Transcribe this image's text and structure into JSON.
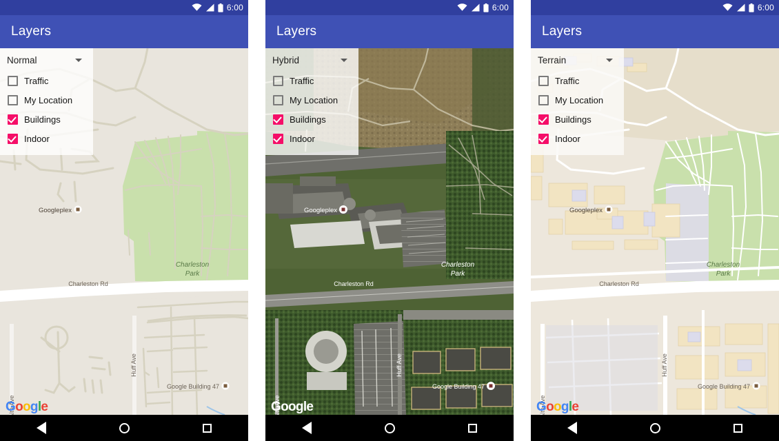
{
  "status_bar": {
    "time": "6:00",
    "icons": [
      "wifi-icon",
      "signal-icon",
      "battery-icon"
    ],
    "background": "#303F9F"
  },
  "app_bar": {
    "title": "Layers",
    "background": "#3F51B5"
  },
  "nav_bar": {
    "back_label": "Back",
    "home_label": "Home",
    "recents_label": "Recents"
  },
  "colors": {
    "accent_checkbox": "#F50E68",
    "app_bar": "#3F51B5",
    "status_bar": "#303F9F",
    "map_land": "#E9E5DD",
    "map_park": "#C9E0AC",
    "map_road": "#FFFFFF"
  },
  "watermark": {
    "letters": [
      "G",
      "o",
      "o",
      "g",
      "l",
      "e"
    ]
  },
  "panels": [
    {
      "id": "normal",
      "map_type": "Normal",
      "layers": [
        {
          "label": "Traffic",
          "checked": false
        },
        {
          "label": "My Location",
          "checked": false
        },
        {
          "label": "Buildings",
          "checked": true
        },
        {
          "label": "Indoor",
          "checked": true
        }
      ],
      "map_labels": {
        "poi": "Googleplex",
        "park": [
          "Charleston",
          "Park"
        ],
        "road_main": "Charleston Rd",
        "road_left": "Alta Ave",
        "road_mid": "Huff Ave",
        "building": "Google Building 47"
      },
      "watermark_style": "dark"
    },
    {
      "id": "hybrid",
      "map_type": "Hybrid",
      "layers": [
        {
          "label": "Traffic",
          "checked": false
        },
        {
          "label": "My Location",
          "checked": false
        },
        {
          "label": "Buildings",
          "checked": true
        },
        {
          "label": "Indoor",
          "checked": true
        }
      ],
      "map_labels": {
        "poi": "Googleplex",
        "park": [
          "Charleston",
          "Park"
        ],
        "road_main": "Charleston Rd",
        "road_left": "Alta Ave",
        "road_mid": "Huff Ave",
        "building": "Google Building 47"
      },
      "watermark_style": "light"
    },
    {
      "id": "terrain",
      "map_type": "Terrain",
      "layers": [
        {
          "label": "Traffic",
          "checked": false
        },
        {
          "label": "My Location",
          "checked": false
        },
        {
          "label": "Buildings",
          "checked": true
        },
        {
          "label": "Indoor",
          "checked": true
        }
      ],
      "map_labels": {
        "poi": "Googleplex",
        "park": [
          "Charleston",
          "Park"
        ],
        "road_main": "Charleston Rd",
        "road_left": "Alta Ave",
        "road_mid": "Huff Ave",
        "building": "Google Building 47"
      },
      "watermark_style": "dark"
    }
  ]
}
